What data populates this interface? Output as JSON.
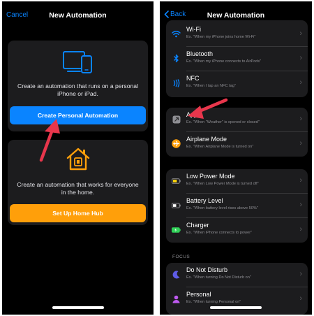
{
  "left": {
    "cancel_label": "Cancel",
    "title": "New Automation",
    "personal": {
      "text": "Create an automation that runs on a personal iPhone or iPad.",
      "button_label": "Create Personal Automation"
    },
    "home": {
      "text": "Create an automation that works for everyone in the home.",
      "button_label": "Set Up Home Hub"
    }
  },
  "right": {
    "back_label": "Back",
    "title": "New Automation",
    "rows": [
      {
        "title": "Wi-Fi",
        "subtitle": "Ex. \"When my iPhone joins home Wi-Fi\"",
        "icon": "wifi-icon"
      },
      {
        "title": "Bluetooth",
        "subtitle": "Ex. \"When my iPhone connects to AirPods\"",
        "icon": "bluetooth-icon"
      },
      {
        "title": "NFC",
        "subtitle": "Ex. \"When I tap an NFC tag\"",
        "icon": "nfc-icon"
      },
      {
        "title": "App",
        "subtitle": "Ex. \"When \"Weather\" is opened or closed\"",
        "icon": "app-icon"
      },
      {
        "title": "Airplane Mode",
        "subtitle": "Ex. \"When Airplane Mode is turned on\"",
        "icon": "airplane-icon"
      },
      {
        "title": "Low Power Mode",
        "subtitle": "Ex. \"When Low Power Mode is turned off\"",
        "icon": "low-power-battery-icon"
      },
      {
        "title": "Battery Level",
        "subtitle": "Ex. \"When battery level rises above 50%\"",
        "icon": "battery-icon"
      },
      {
        "title": "Charger",
        "subtitle": "Ex. \"When iPhone connects to power\"",
        "icon": "charger-icon"
      },
      {
        "title": "Do Not Disturb",
        "subtitle": "Ex. \"When turning Do Not Disturb on\"",
        "icon": "moon-icon"
      },
      {
        "title": "Personal",
        "subtitle": "Ex. \"When turning Personal on\"",
        "icon": "person-icon"
      }
    ],
    "section_focus": "FOCUS"
  },
  "colors": {
    "accent_blue": "#0a84ff",
    "home_orange": "#ff9f0a",
    "arrow_red": "#e8364c",
    "card_bg": "#1c1c1e",
    "focus_purple": "#5e5ce6"
  }
}
